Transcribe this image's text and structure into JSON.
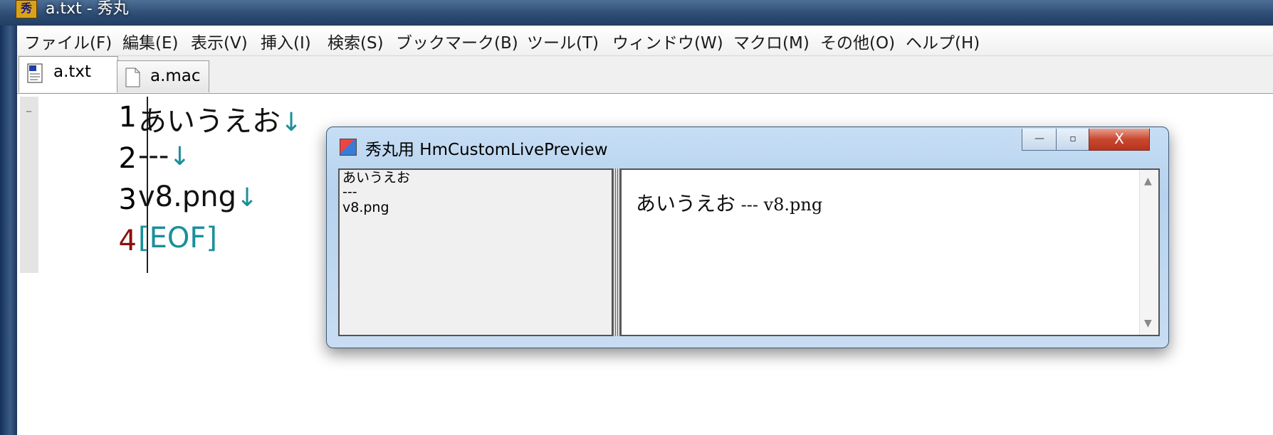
{
  "window": {
    "title": "a.txt  - 秀丸",
    "icon": "hidemaru-app-icon"
  },
  "menu": [
    "ファイル(F)",
    "編集(E)",
    "表示(V)",
    "挿入(I)",
    "検索(S)",
    "ブックマーク(B)",
    "ツール(T)",
    "ウィンドウ(W)",
    "マクロ(M)",
    "その他(O)",
    "ヘルプ(H)"
  ],
  "tabs": [
    {
      "label": "a.txt",
      "active": true,
      "icon": "text-document-icon"
    },
    {
      "label": "a.mac",
      "active": false,
      "icon": "blank-document-icon"
    }
  ],
  "editor": {
    "fold_mark": "–",
    "lines": [
      {
        "num": "1",
        "text": "あいうえお",
        "newline": "↓"
      },
      {
        "num": "2",
        "text": "---",
        "newline": "↓"
      },
      {
        "num": "3",
        "text": "v8.png",
        "newline": "↓"
      },
      {
        "num": "4",
        "text": "[EOF]",
        "newline": ""
      }
    ]
  },
  "dialog": {
    "title": "秀丸用 HmCustomLivePreview",
    "controls": {
      "minimize": "—",
      "maximize": "▫",
      "close": "X"
    },
    "source_lines": [
      "あいうえお",
      "---",
      "v8.png"
    ],
    "preview": {
      "main": "あいうえお",
      "rest": " --- v8.png"
    },
    "scroll": {
      "up": "▲",
      "down": "▼"
    }
  },
  "colors": {
    "eof": "#1a8f9a",
    "current_line_number": "#8b1010",
    "close_button": "#c9472f"
  }
}
